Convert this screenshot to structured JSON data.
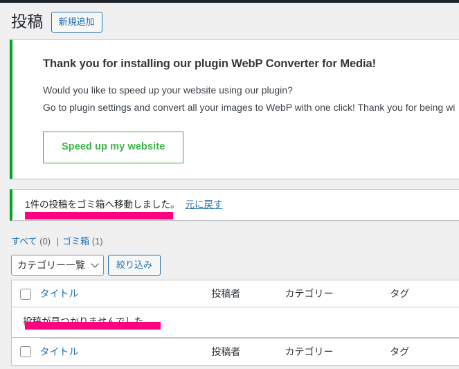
{
  "admin_bar": {
    "present": true
  },
  "header": {
    "page_title": "投稿",
    "add_new_label": "新規追加"
  },
  "plugin_notice": {
    "accent_color": "#00a32a",
    "heading": "Thank you for installing our plugin WebP Converter for Media!",
    "line1": "Would you like to speed up your website using our plugin?",
    "line2": "Go to plugin settings and convert all your images to WebP with one click! Thank you for being wi",
    "button_label": "Speed up my website",
    "button_color": "#3eb54b"
  },
  "trash_notice": {
    "accent_color": "#00a32a",
    "message": "1件の投稿をゴミ箱へ移動しました。",
    "undo_label": "元に戻す",
    "highlight_color": "#ff0080"
  },
  "filters": {
    "all_label": "すべて",
    "all_count": "(0)",
    "separator": "|",
    "trash_label": "ゴミ箱",
    "trash_count": "(1)",
    "category_select_value": "カテゴリー一覧",
    "select_caret_icon": "chevron-down-icon",
    "filter_button_label": "絞り込み"
  },
  "table": {
    "columns": {
      "select_all": "select-all-checkbox",
      "title": "タイトル",
      "author": "投稿者",
      "categories": "カテゴリー",
      "tags": "タグ"
    },
    "empty_message": "投稿が見つかりませんでした。",
    "empty_highlight_color": "#ff0080"
  }
}
